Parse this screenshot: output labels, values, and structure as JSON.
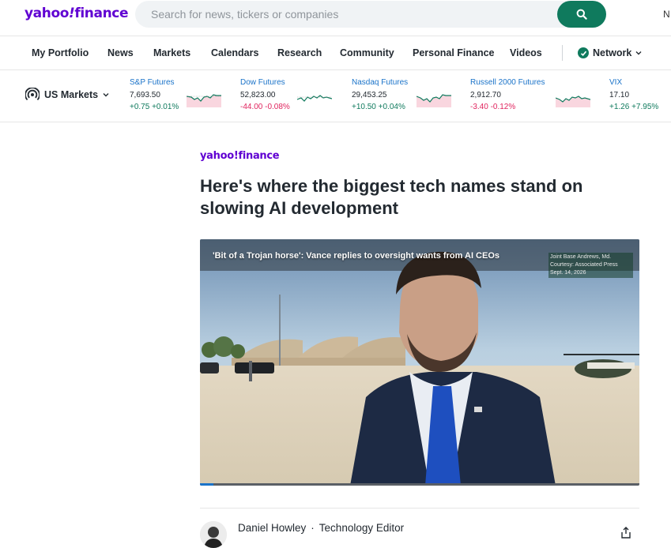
{
  "brand": {
    "logo_text": "yahoo!finance",
    "logo_main": "yahoo",
    "logo_bang": "!",
    "logo_tail": "finance",
    "color": "#6001d2"
  },
  "search": {
    "placeholder": "Search for news, tickers or companies",
    "button_icon": "search-icon",
    "accent": "#0f7a5d"
  },
  "header_edge_text": "N",
  "nav": {
    "items": [
      "My Portfolio",
      "News",
      "Markets",
      "Calendars",
      "Research",
      "Community",
      "Personal Finance",
      "Videos"
    ],
    "network_label": "Network",
    "network_icon": "checkmark-icon"
  },
  "markets": {
    "label": "US Markets",
    "icon": "broadcast-icon",
    "tickers": [
      {
        "name": "S&P Futures",
        "value": "7,693.50",
        "change": "+0.75 +0.01%",
        "direction": "up"
      },
      {
        "name": "Dow Futures",
        "value": "52,823.00",
        "change": "-44.00 -0.08%",
        "direction": "down"
      },
      {
        "name": "Nasdaq Futures",
        "value": "29,453.25",
        "change": "+10.50 +0.04%",
        "direction": "up"
      },
      {
        "name": "Russell 2000 Futures",
        "value": "2,912.70",
        "change": "-3.40 -0.12%",
        "direction": "down"
      },
      {
        "name": "VIX",
        "value": "17.10",
        "change": "+1.26 +7.95%",
        "direction": "up"
      }
    ],
    "colors": {
      "up": "#0f7a5d",
      "down": "#e0245e"
    }
  },
  "article": {
    "brand": "yahoo!finance",
    "headline": "Here's where the biggest tech names stand on slowing AI development",
    "video": {
      "caption": "'Bit of a Trojan horse': Vance replies to oversight wants from AI CEOs",
      "credit_lines": [
        "Joint Base Andrews, Md.",
        "Courtesy: Associated Press",
        "Sept. 14, 2026"
      ],
      "progress": 0.03
    },
    "author": {
      "name": "Daniel Howley",
      "separator": "·",
      "title": "Technology Editor"
    },
    "share_icon": "share-icon"
  }
}
